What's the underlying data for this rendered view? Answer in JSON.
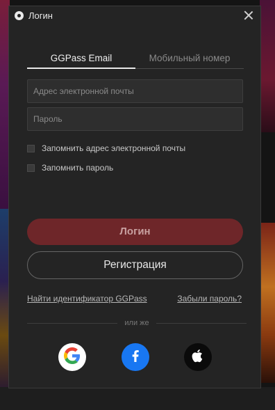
{
  "dialog": {
    "title": "Логин"
  },
  "tabs": [
    {
      "label": "GGPass Email",
      "active": true
    },
    {
      "label": "Мобильный номер",
      "active": false
    }
  ],
  "form": {
    "email_placeholder": "Адрес электронной почты",
    "password_placeholder": "Пароль",
    "remember_email_label": "Запомнить адрес электронной почты",
    "remember_password_label": "Запомнить пароль"
  },
  "buttons": {
    "login_label": "Логин",
    "register_label": "Регистрация"
  },
  "links": {
    "find_id": "Найти идентификатор GGPass",
    "forgot_password": "Забыли пароль?"
  },
  "divider_text": "или же",
  "social": [
    {
      "icon": "google-icon"
    },
    {
      "icon": "facebook-icon"
    },
    {
      "icon": "apple-icon"
    }
  ],
  "colors": {
    "dialog_bg": "#242424",
    "login_button": "#6e2629",
    "facebook_blue": "#1877f2"
  }
}
